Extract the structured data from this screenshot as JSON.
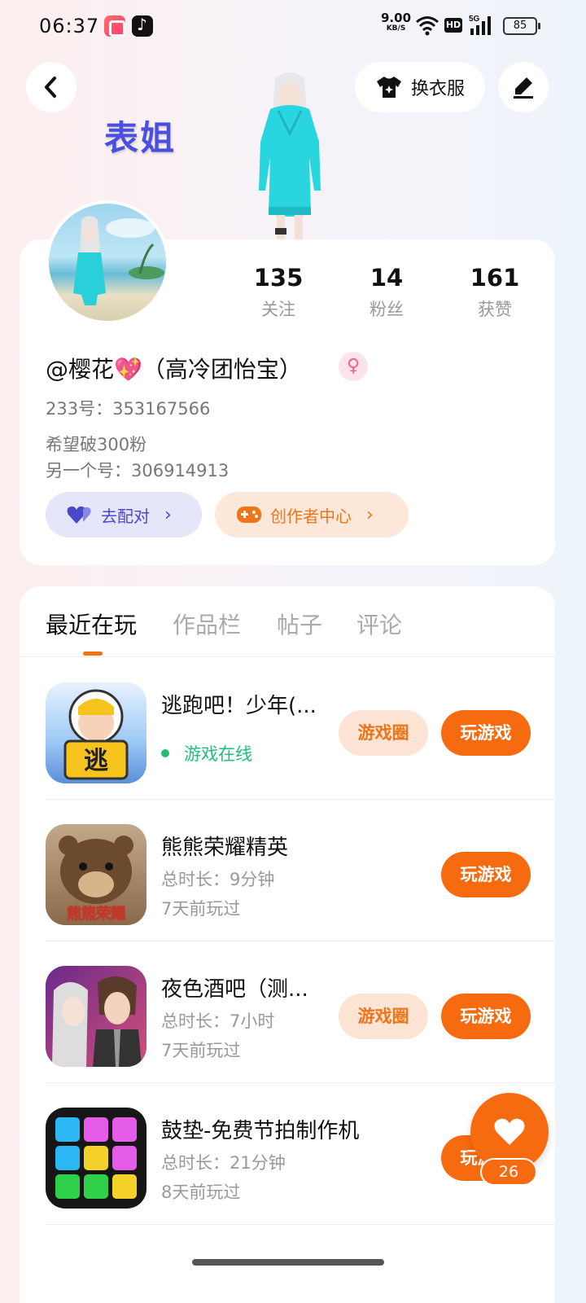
{
  "status_bar": {
    "time": "06:37",
    "net_speed": "9.00",
    "net_unit": "KB/S",
    "hd": "HD",
    "battery": "85",
    "icons": [
      "app-icon",
      "tiktok-icon",
      "wifi-icon",
      "signal-5g-icon",
      "battery-icon"
    ]
  },
  "header": {
    "outfit_label": "换衣服",
    "nickname_display": "表姐"
  },
  "profile": {
    "stats": [
      {
        "value": "135",
        "label": "关注"
      },
      {
        "value": "14",
        "label": "粉丝"
      },
      {
        "value": "161",
        "label": "获赞"
      }
    ],
    "username": "@樱花💖（高冷团怡宝）",
    "gender_icon": "female-icon",
    "id_line": "233号：353167566",
    "bio_lines": [
      "希望破300粉",
      "另一个号：306914913"
    ],
    "pair_label": "去配对",
    "creator_label": "创作者中心"
  },
  "tabs": [
    "最近在玩",
    "作品栏",
    "帖子",
    "评论"
  ],
  "games": [
    {
      "name": "逃跑吧！少年(...",
      "status": "游戏在线",
      "circle": "游戏圈",
      "play": "玩游戏"
    },
    {
      "name": "熊熊荣耀精英",
      "duration": "总时长：9分钟",
      "last": "7天前玩过",
      "play": "玩游戏"
    },
    {
      "name": "夜色酒吧（测...",
      "duration": "总时长：7小时",
      "last": "7天前玩过",
      "circle": "游戏圈",
      "play": "玩游戏"
    },
    {
      "name": "鼓垫-免费节拍制作机",
      "duration": "总时长：21分钟",
      "last": "8天前玩过",
      "play": "玩游戏"
    }
  ],
  "icon_text": {
    "game1": "逃",
    "game2": "熊熊荣耀"
  },
  "like": {
    "count": "26"
  },
  "colors": {
    "accent": "#f76b10",
    "purple": "#4c49c8",
    "online": "#1fbf7a"
  }
}
